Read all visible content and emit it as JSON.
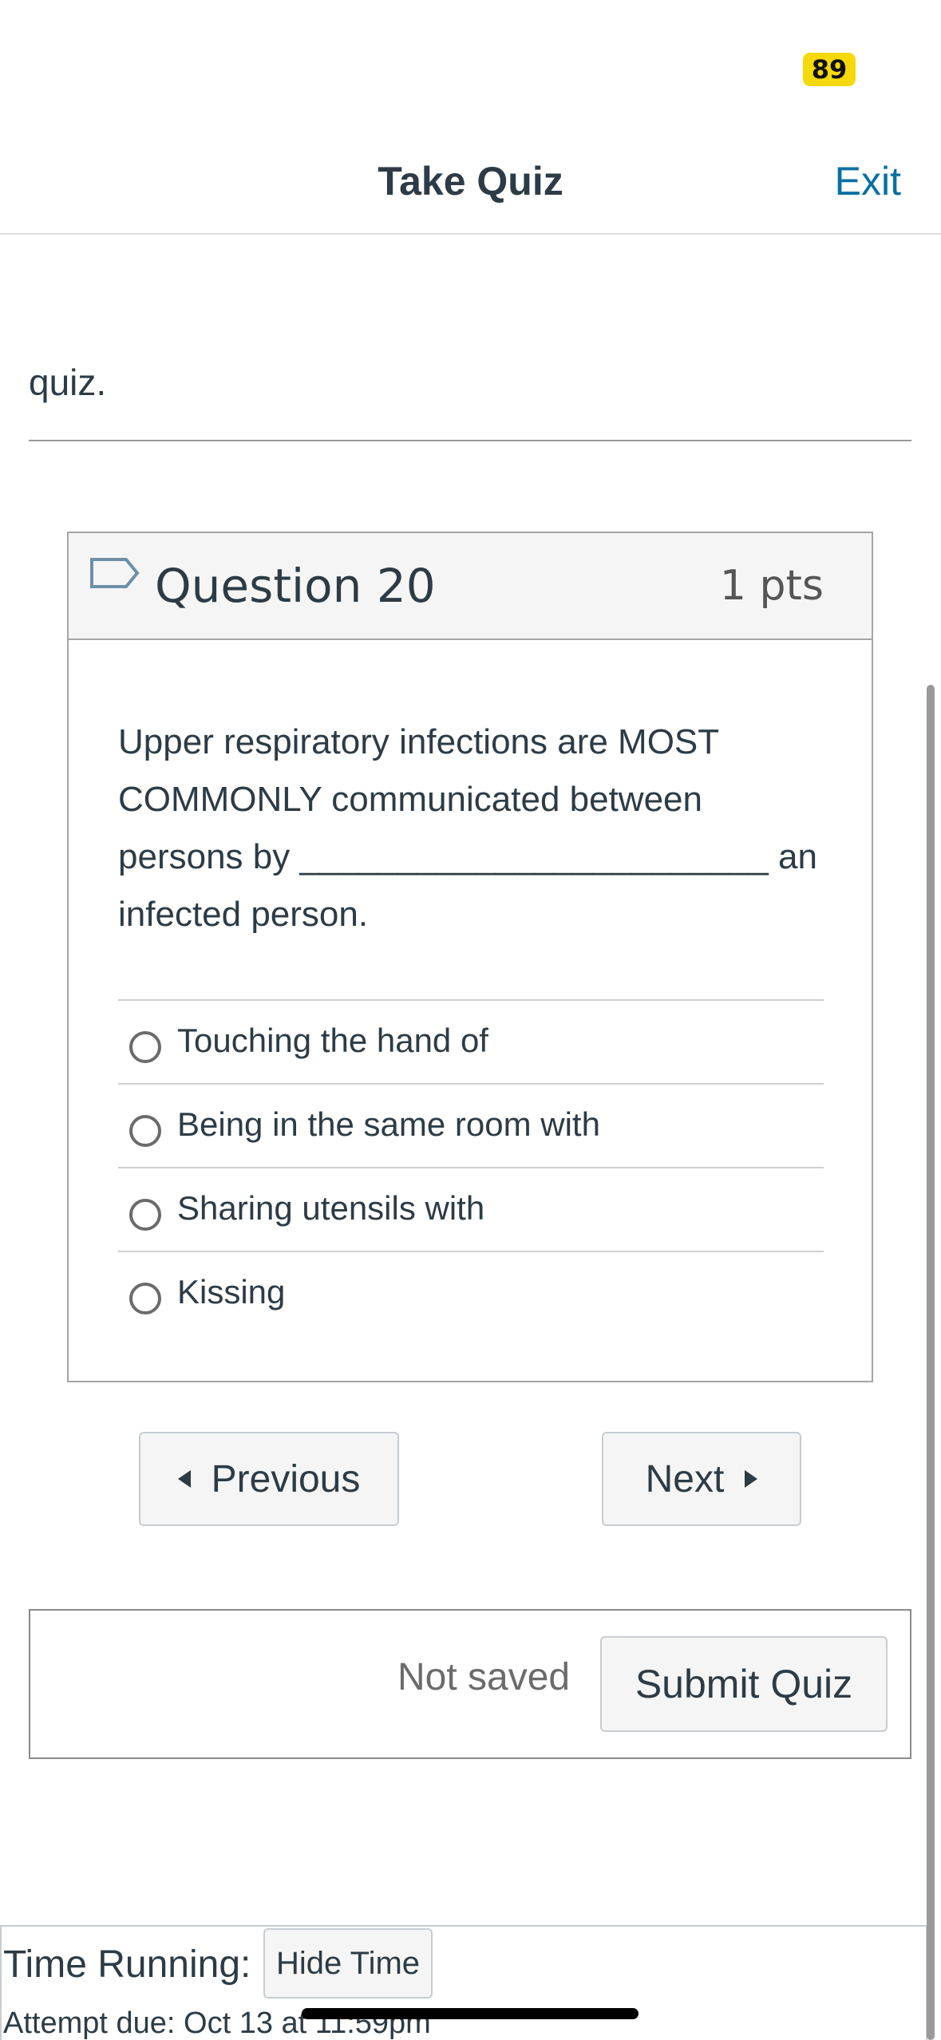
{
  "status": {
    "badge": "89"
  },
  "header": {
    "title": "Take Quiz",
    "exit_label": "Exit"
  },
  "intro": {
    "fragment": "quiz."
  },
  "question": {
    "title": "Question 20",
    "points": "1 pts",
    "text": "Upper respiratory infections are MOST COMMONLY communicated between persons by ________________________ an infected person.",
    "answers": [
      {
        "label": "Touching the hand of"
      },
      {
        "label": "Being in the same room with"
      },
      {
        "label": "Sharing utensils with"
      },
      {
        "label": "Kissing"
      }
    ]
  },
  "navigation": {
    "previous_label": "Previous",
    "next_label": "Next"
  },
  "submit": {
    "status": "Not saved",
    "button_label": "Submit Quiz"
  },
  "timer": {
    "label": "Time Running:",
    "hide_label": "Hide Time",
    "attempt_due": "Attempt due: Oct 13 at 11:59pm"
  },
  "icons": {
    "flag": "flag-icon",
    "prev": "triangle-left-icon",
    "next": "triangle-right-icon"
  },
  "colors": {
    "accent": "#0770a3",
    "badge": "#f5d90a",
    "text": "#2d3b45"
  }
}
